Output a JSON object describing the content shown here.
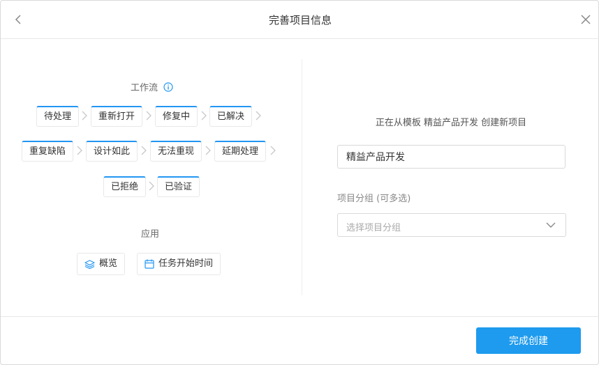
{
  "header": {
    "title": "完善项目信息",
    "back_icon": "chevron-left-icon",
    "close_icon": "close-icon"
  },
  "workflow": {
    "title": "工作流",
    "info_icon": "info-icon",
    "accent_color": "#2196f3",
    "states": [
      "待处理",
      "重新打开",
      "修复中",
      "已解决",
      "重复缺陷",
      "设计如此",
      "无法重现",
      "延期处理",
      "已拒绝",
      "已验证"
    ]
  },
  "apps": {
    "title": "应用",
    "items": [
      {
        "label": "概览",
        "icon": "layers-icon"
      },
      {
        "label": "任务开始时间",
        "icon": "calendar-icon"
      }
    ]
  },
  "form": {
    "template_text": "正在从模板 精益产品开发 创建新项目",
    "project_name": "精益产品开发",
    "group_label": "项目分组 (可多选)",
    "group_placeholder": "选择项目分组"
  },
  "footer": {
    "submit_label": "完成创建",
    "button_color": "#1e9bee"
  }
}
